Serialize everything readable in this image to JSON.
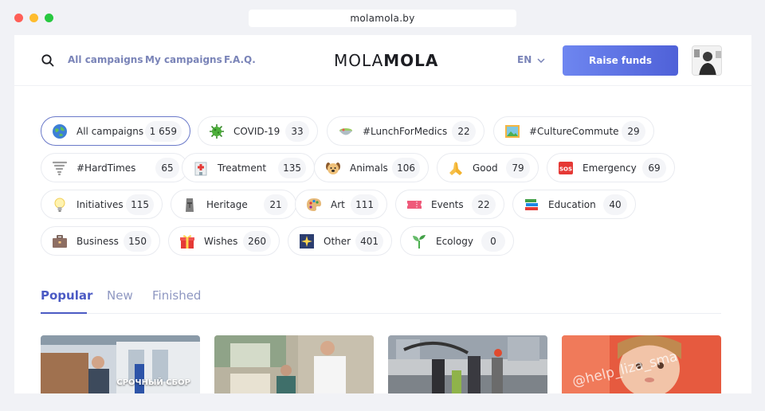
{
  "browser": {
    "url": "molamola.by"
  },
  "header": {
    "nav": [
      "All campaigns",
      "My campaigns",
      "F.A.Q."
    ],
    "logo": {
      "part1": "MOLA",
      "part2": "MOLA"
    },
    "lang": "EN",
    "raise_button": "Raise funds"
  },
  "categories": [
    {
      "label": "All campaigns",
      "count": "1 659",
      "icon": "globe-icon"
    },
    {
      "label": "COVID-19",
      "count": "33",
      "icon": "virus-icon"
    },
    {
      "label": "#LunchForMedics",
      "count": "22",
      "icon": "bowl-icon"
    },
    {
      "label": "#CultureCommute",
      "count": "29",
      "icon": "picture-icon"
    },
    {
      "label": "#HardTimes",
      "count": "65",
      "icon": "tornado-icon"
    },
    {
      "label": "Treatment",
      "count": "135",
      "icon": "hospital-icon"
    },
    {
      "label": "Animals",
      "count": "106",
      "icon": "dog-icon"
    },
    {
      "label": "Good",
      "count": "79",
      "icon": "praying-hands-icon"
    },
    {
      "label": "Emergency",
      "count": "69",
      "icon": "sos-icon"
    },
    {
      "label": "Initiatives",
      "count": "115",
      "icon": "lightbulb-icon"
    },
    {
      "label": "Heritage",
      "count": "21",
      "icon": "moai-icon"
    },
    {
      "label": "Art",
      "count": "111",
      "icon": "palette-icon"
    },
    {
      "label": "Events",
      "count": "22",
      "icon": "ticket-icon"
    },
    {
      "label": "Education",
      "count": "40",
      "icon": "books-icon"
    },
    {
      "label": "Business",
      "count": "150",
      "icon": "briefcase-icon"
    },
    {
      "label": "Wishes",
      "count": "260",
      "icon": "gift-icon"
    },
    {
      "label": "Other",
      "count": "401",
      "icon": "sparkle-icon"
    },
    {
      "label": "Ecology",
      "count": "0",
      "icon": "seedling-icon"
    }
  ],
  "tabs": [
    "Popular",
    "New",
    "Finished"
  ],
  "cards": [
    {
      "caption": "СРОЧНЫЙ СБОР"
    },
    {
      "caption": ""
    },
    {
      "caption": ""
    },
    {
      "watermark": "@help_liza_sma"
    }
  ],
  "colors": {
    "accent": "#4b5ac4",
    "nav": "#7a84b8",
    "button_gradient_start": "#6e86f0",
    "button_gradient_end": "#4f61d8"
  }
}
